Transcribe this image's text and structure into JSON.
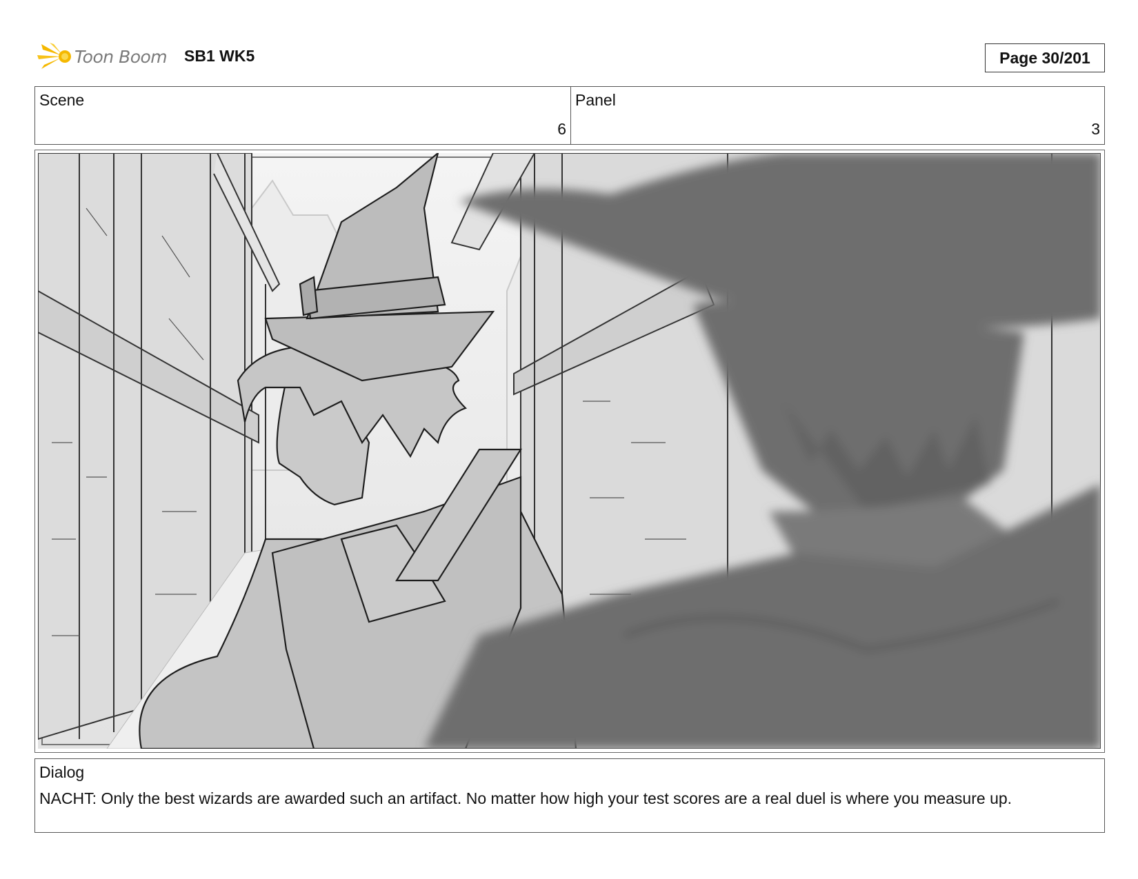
{
  "header": {
    "logo_text": "Toon Boom",
    "project": "SB1 WK5",
    "page": "Page  30/201"
  },
  "info": {
    "scene_label": "Scene",
    "scene_value": "6",
    "panel_label": "Panel",
    "panel_value": "3"
  },
  "dialog": {
    "label": "Dialog",
    "text": "NACHT: Only the best wizards are awarded such an artifact. No matter how high your test scores are a real duel is where you measure up."
  },
  "colors": {
    "logo_flare": "#f5b800",
    "frame_border": "#666666"
  }
}
